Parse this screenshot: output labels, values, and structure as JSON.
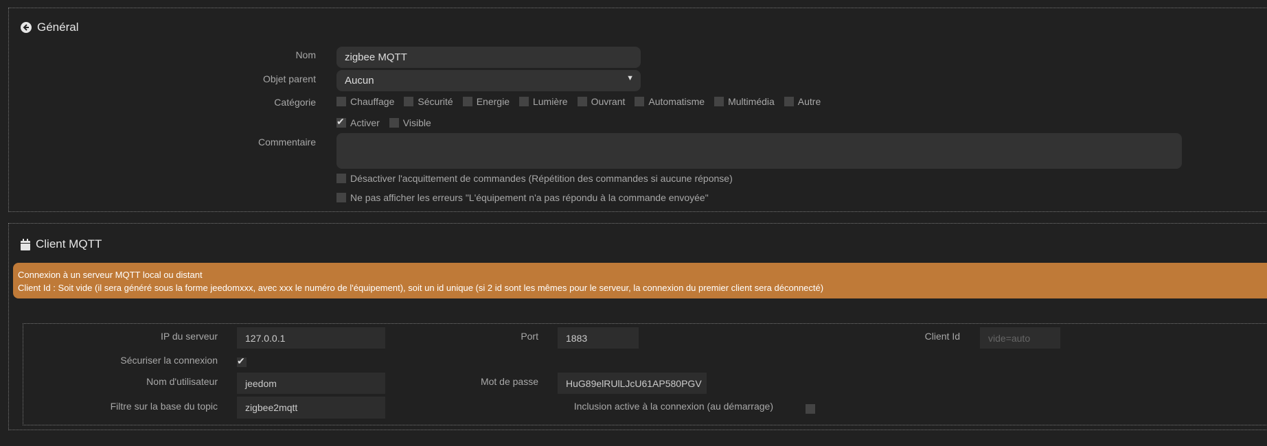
{
  "general": {
    "title": "Général",
    "icon": "arrow-circle-left-icon",
    "nom_label": "Nom",
    "nom_value": "zigbee MQTT",
    "parent_label": "Objet parent",
    "parent_value": "Aucun",
    "categorie_label": "Catégorie",
    "categories": [
      {
        "label": "Chauffage",
        "checked": false
      },
      {
        "label": "Sécurité",
        "checked": false
      },
      {
        "label": "Energie",
        "checked": false
      },
      {
        "label": "Lumière",
        "checked": false
      },
      {
        "label": "Ouvrant",
        "checked": false
      },
      {
        "label": "Automatisme",
        "checked": false
      },
      {
        "label": "Multimédia",
        "checked": false
      },
      {
        "label": "Autre",
        "checked": false
      }
    ],
    "activer_label": "Activer",
    "visible_label": "Visible",
    "commentaire_label": "Commentaire",
    "ack_label": "Désactiver l'acquittement de commandes (Répétition des commandes si aucune réponse)",
    "errors_label": "Ne pas afficher les erreurs \"L'équipement n'a pas répondu à la commande envoyée\""
  },
  "mqtt": {
    "title": "Client MQTT",
    "icon": "calendar-icon",
    "alert_line1": "Connexion à un serveur MQTT local ou distant",
    "alert_line2": "Client Id : Soit vide (il sera généré sous la forme jeedomxxx, avec xxx le numéro de l'équipement), soit un id unique (si 2 id sont les mêmes pour le serveur, la connexion du premier client sera déconnecté)",
    "alert_color": "#bf7a38",
    "ip_label": "IP du serveur",
    "ip_value": "127.0.0.1",
    "port_label": "Port",
    "port_value": "1883",
    "clientid_label": "Client Id",
    "clientid_placeholder": "vide=auto",
    "secure_label": "Sécuriser la connexion",
    "user_label": "Nom d'utilisateur",
    "user_value": "jeedom",
    "pass_label": "Mot de passe",
    "pass_value": "HuG89elRUlLJcU61AP580PGV",
    "topic_label": "Filtre sur la base du topic",
    "topic_value": "zigbee2mqtt",
    "inclusion_label": "Inclusion active à la connexion (au démarrage)"
  }
}
